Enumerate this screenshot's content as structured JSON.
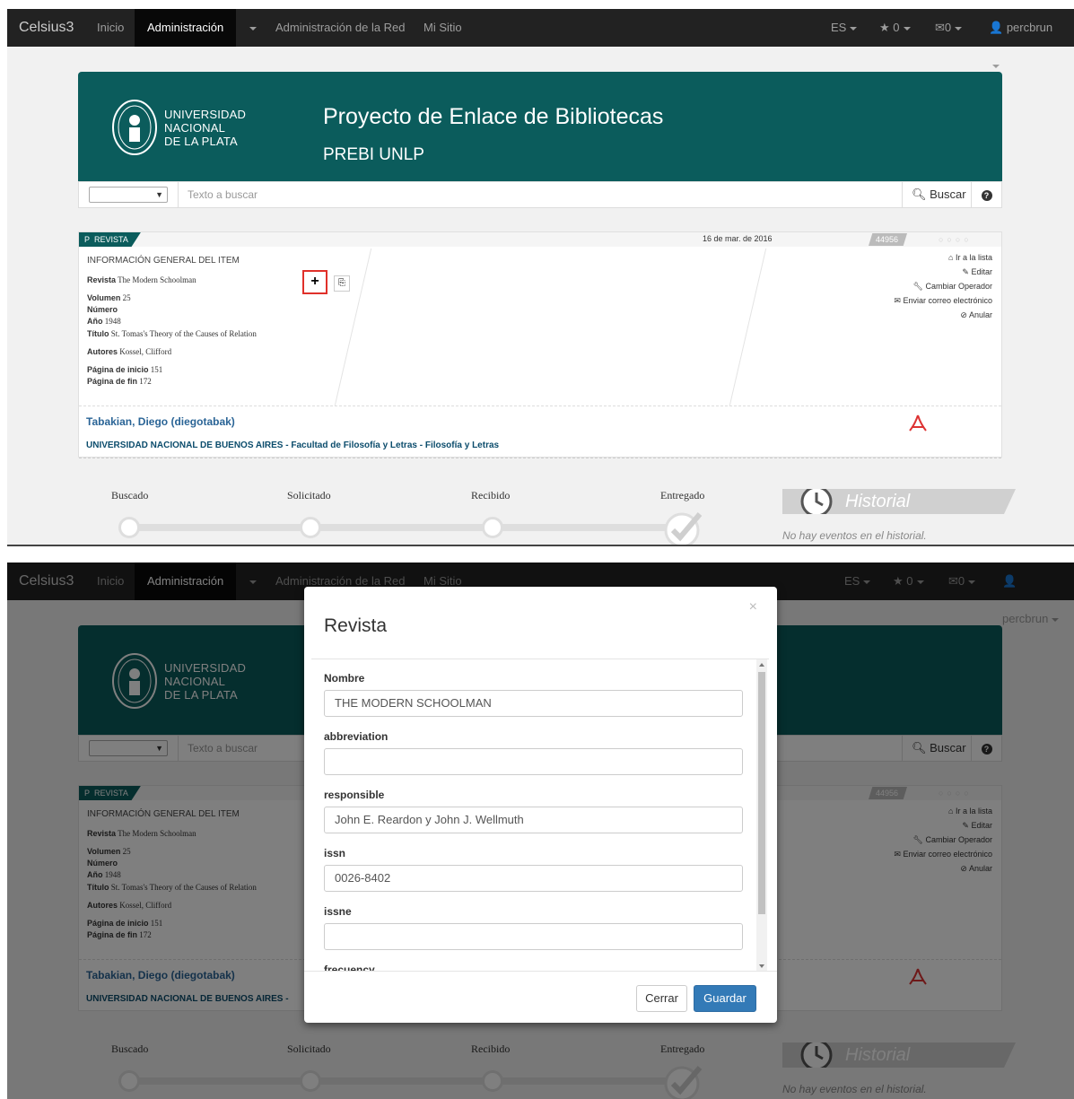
{
  "navbar": {
    "brand": "Celsius3",
    "items": [
      {
        "label": "Inicio"
      },
      {
        "label": "Administración"
      },
      {
        "label": ""
      },
      {
        "label": "Administración de la Red"
      },
      {
        "label": "Mi Sitio"
      }
    ],
    "right": {
      "lang": "ES",
      "stars": "0",
      "messages": "0",
      "user": "percbrun"
    }
  },
  "header": {
    "university_lines": [
      "UNIVERSIDAD",
      "NACIONAL",
      "DE LA PLATA"
    ],
    "title": "Proyecto de Enlace de Bibliotecas",
    "subtitle": "PREBI UNLP"
  },
  "search": {
    "placeholder": "Texto a buscar",
    "button_label": "Buscar"
  },
  "request": {
    "type_letter": "P",
    "type": "REVISTA",
    "date": "16 de mar. de 2016",
    "id": "44956",
    "info_heading": "INFORMACIÓN GENERAL DEL ITEM",
    "fields": [
      {
        "label": "Revista",
        "value": "The Modern Schoolman"
      },
      {
        "label": "Volumen",
        "value": "25"
      },
      {
        "label": "Número",
        "value": ""
      },
      {
        "label": "Año",
        "value": "1948"
      },
      {
        "label": "Título",
        "value": "St. Tomas's Theory of the Causes of Relation"
      },
      {
        "label": "Autores",
        "value": "Kossel, Clifford"
      },
      {
        "label": "Página de inicio",
        "value": "151"
      },
      {
        "label": "Página de fin",
        "value": "172"
      }
    ],
    "actions": [
      "Ir a la lista",
      "Editar",
      "Cambiar Operador",
      "Enviar correo electrónico",
      "Anular"
    ],
    "user": "Tabakian, Diego (diegotabak)",
    "institution": "UNIVERSIDAD NACIONAL DE BUENOS AIRES - Facultad de Filosofía y Letras - Filosofía y Letras",
    "institution_short": "UNIVERSIDAD NACIONAL DE BUENOS AIRES -"
  },
  "steps": [
    "Buscado",
    "Solicitado",
    "Recibido",
    "Entregado"
  ],
  "history": {
    "title": "Historial",
    "empty": "No hay eventos en el historial."
  },
  "modal": {
    "title": "Revista",
    "close": "×",
    "fields": [
      {
        "label": "Nombre",
        "value": "THE MODERN SCHOOLMAN"
      },
      {
        "label": "abbreviation",
        "value": ""
      },
      {
        "label": "responsible",
        "value": "John E. Reardon y John J. Wellmuth"
      },
      {
        "label": "issn",
        "value": "0026-8402"
      },
      {
        "label": "issne",
        "value": ""
      },
      {
        "label": "frecuency",
        "value": ""
      }
    ],
    "close_label": "Cerrar",
    "save_label": "Guardar"
  },
  "colors": {
    "brand_teal": "#0b5c5c",
    "navbar": "#222222",
    "primary": "#337ab7",
    "highlight": "#e0302a"
  }
}
